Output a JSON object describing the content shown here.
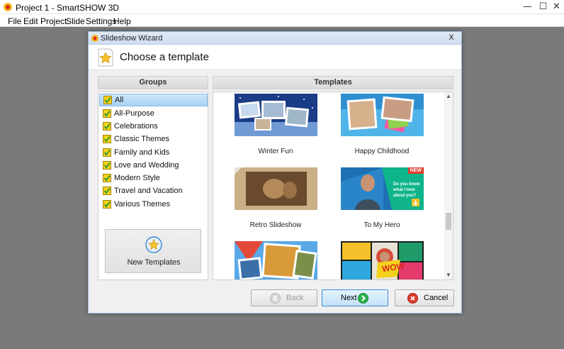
{
  "app": {
    "title": "Project 1 - SmartSHOW 3D",
    "window_controls": {
      "minimize": "—",
      "maximize": "☐",
      "close": "✕"
    }
  },
  "menu": [
    "File",
    "Edit",
    "Project",
    "Slide",
    "Settings",
    "Help"
  ],
  "dialog": {
    "title": "Slideshow Wizard",
    "close": "x",
    "heading": "Choose a template",
    "groups_header": "Groups",
    "templates_header": "Templates",
    "groups": [
      {
        "label": "All",
        "selected": true
      },
      {
        "label": "All-Purpose",
        "selected": false
      },
      {
        "label": "Celebrations",
        "selected": false
      },
      {
        "label": "Classic Themes",
        "selected": false
      },
      {
        "label": "Family and Kids",
        "selected": false
      },
      {
        "label": "Love and Wedding",
        "selected": false
      },
      {
        "label": "Modern Style",
        "selected": false
      },
      {
        "label": "Travel and Vacation",
        "selected": false
      },
      {
        "label": "Various Themes",
        "selected": false
      }
    ],
    "new_templates_label": "New Templates",
    "templates": [
      {
        "label": "Winter Fun",
        "badge": "",
        "thumb_icon": "winter-thumbnail"
      },
      {
        "label": "Happy Childhood",
        "badge": "",
        "thumb_icon": "childhood-thumbnail"
      },
      {
        "label": "Retro Slideshow",
        "badge": "",
        "thumb_icon": "retro-thumbnail"
      },
      {
        "label": "To My Hero",
        "badge": "NEW",
        "thumb_icon": "hero-thumbnail",
        "thumb_text": "Do you know what I love about you?"
      },
      {
        "label": "",
        "badge": "",
        "thumb_icon": "travel-collage-thumbnail"
      },
      {
        "label": "",
        "badge": "",
        "thumb_icon": "comic-thumbnail",
        "thumb_text": "WOW"
      }
    ],
    "buttons": {
      "back": "Back",
      "next": "Next",
      "cancel": "Cancel"
    },
    "colors": {
      "accent": "#3c8ad8",
      "selected": "#a9d2f5",
      "next_icon": "#2bb24c",
      "cancel_icon": "#d93b2b",
      "badge": "#e53b2c"
    }
  }
}
